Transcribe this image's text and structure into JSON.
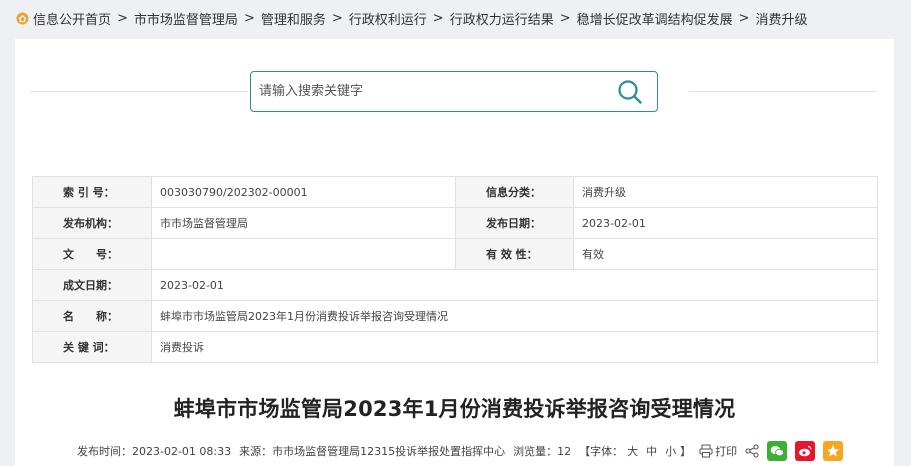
{
  "breadcrumb": {
    "items": [
      "信息公开首页",
      "市市场监督管理局",
      "管理和服务",
      "行政权利运行",
      "行政权力运行结果",
      "稳增长促改革调结构促发展",
      "消费升级"
    ],
    "separator": ">"
  },
  "search": {
    "placeholder": "请输入搜索关键字",
    "value": ""
  },
  "meta": {
    "index_label": "索 引 号：",
    "index_value": "003030790/202302-00001",
    "category_label": "信息分类：",
    "category_value": "消费升级",
    "publisher_label": "发布机构：",
    "publisher_value": "市市场监督管理局",
    "pubdate_label": "发布日期：",
    "pubdate_value": "2023-02-01",
    "docno_label": "文　　号：",
    "docno_value": "",
    "validity_label": "有 效 性：",
    "validity_value": "有效",
    "created_label": "成文日期：",
    "created_value": "2023-02-01",
    "name_label": "名　　称：",
    "name_value": "蚌埠市市场监管局2023年1月份消费投诉举报咨询受理情况",
    "keywords_label": "关 键 词：",
    "keywords_value": "消费投诉"
  },
  "article": {
    "title": "蚌埠市市场监管局2023年1月份消费投诉举报咨询受理情况",
    "time_label": "发布时间：",
    "time_value": "2023-02-01 08:33",
    "source_label": "来源：",
    "source_value": "市市场监督管理局12315投诉举报处置指挥中心",
    "views_label": "浏览量：",
    "views_value": "12",
    "font_open": "【字体：",
    "font_large": "大",
    "font_medium": "中",
    "font_small": "小",
    "font_close": "】",
    "print_label": "打印"
  },
  "colors": {
    "accent": "#2d8aa0",
    "wechat": "#3cb034",
    "weibo": "#e6162d",
    "qzone": "#f5a623"
  }
}
